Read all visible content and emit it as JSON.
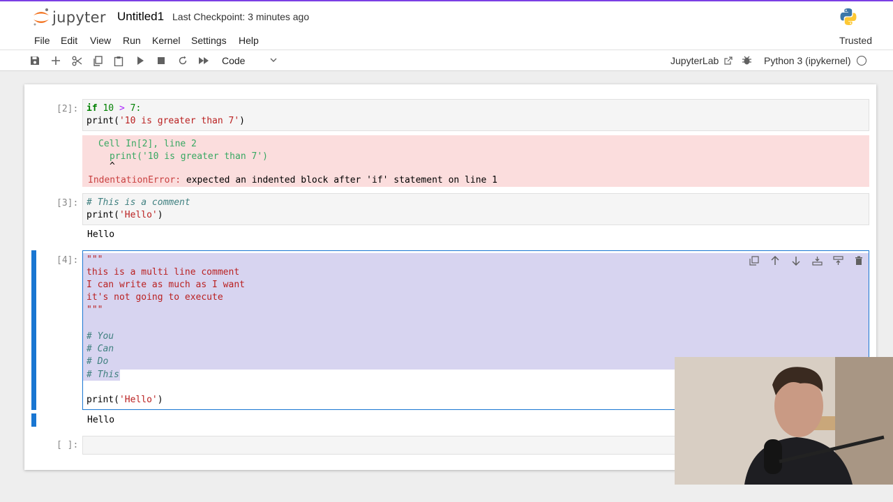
{
  "header": {
    "logo_text": "jupyter",
    "notebook_title": "Untitled1",
    "checkpoint": "Last Checkpoint: 3 minutes ago"
  },
  "menu": {
    "items": [
      "File",
      "Edit",
      "View",
      "Run",
      "Kernel",
      "Settings",
      "Help"
    ],
    "trusted": "Trusted"
  },
  "toolbar": {
    "cell_type": "Code",
    "jupyterlab": "JupyterLab",
    "kernel": "Python 3 (ipykernel)"
  },
  "cells": {
    "c2": {
      "prompt": "[2]:",
      "line1": [
        "if",
        " 10 ",
        ">",
        " 7:"
      ],
      "line2": [
        "print(",
        "'10 is greater than 7'",
        ")"
      ],
      "error_loc": "Cell In[2], line 2",
      "error_code": "print('10 is greater than 7')",
      "error_caret": "^",
      "error_name": "IndentationError:",
      "error_msg": " expected an indented block after 'if' statement on line 1"
    },
    "c3": {
      "prompt": "[3]:",
      "line1": "# This is a comment",
      "line2": [
        "print(",
        "'Hello'",
        ")"
      ],
      "output": "Hello"
    },
    "c4": {
      "prompt": "[4]:",
      "lines": [
        "\"\"\"",
        "this is a multi line comment",
        "I can write as much as I want",
        "it's not going to execute",
        "\"\"\""
      ],
      "comments": [
        "# You",
        "# Can",
        "# Do",
        "# This"
      ],
      "print_line": [
        "print(",
        "'Hello'",
        ")"
      ],
      "output": "Hello"
    },
    "c5": {
      "prompt": "[ ]:"
    }
  },
  "colors": {
    "accent": "#1976d2",
    "selection": "#d7d4f0",
    "error_bg": "#fbdddd"
  }
}
